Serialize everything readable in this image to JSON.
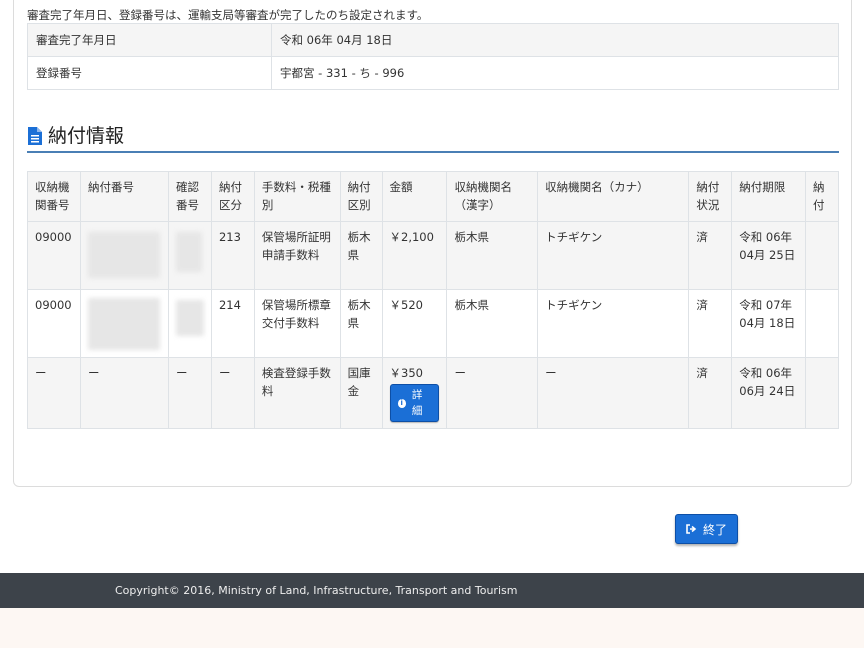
{
  "notice": "審査完了年月日、登録番号は、運輸支局等審査が完了したのち設定されます。",
  "registration": {
    "rows": [
      {
        "label": "審査完了年月日",
        "value": "令和 06年 04月 18日"
      },
      {
        "label": "登録番号",
        "value": "宇都宮 - 331 - ち - 996"
      }
    ]
  },
  "section": {
    "title": "納付情報",
    "icon": "document-icon"
  },
  "payment": {
    "headers": [
      "収納機関番号",
      "納付番号",
      "確認番号",
      "納付区分",
      "手数料・税種別",
      "納付区別",
      "金額",
      "収納機関名（漢字）",
      "収納機関名（カナ）",
      "納付状況",
      "納付期限",
      "納付"
    ],
    "rows": [
      {
        "agency_no": "09000",
        "category": "213",
        "fee_type": "保管場所証明申請手数料",
        "division": "栃木県",
        "amount": "￥2,100",
        "agency_kanji": "栃木県",
        "agency_kana": "トチギケン",
        "status": "済",
        "deadline": "令和 06年 04月 25日"
      },
      {
        "agency_no": "09000",
        "category": "214",
        "fee_type": "保管場所標章交付手数料",
        "division": "栃木県",
        "amount": "￥520",
        "agency_kanji": "栃木県",
        "agency_kana": "トチギケン",
        "status": "済",
        "deadline": "令和 07年 04月 18日"
      },
      {
        "agency_no": "ー",
        "pay_no": "ー",
        "confirm_no": "ー",
        "category": "ー",
        "fee_type": "検査登録手数料",
        "division": "国庫金",
        "amount": "￥350",
        "detail_label": "詳細",
        "agency_kanji": "ー",
        "agency_kana": "ー",
        "status": "済",
        "deadline": "令和 06年 06月 24日"
      }
    ]
  },
  "end_button": "終了",
  "footer": "Copyright© 2016, Ministry of Land, Infrastructure, Transport and Tourism",
  "colors": {
    "accent": "#1b6fd6",
    "section_rule": "#4a7fb5",
    "footer_bg": "#3d434a"
  }
}
